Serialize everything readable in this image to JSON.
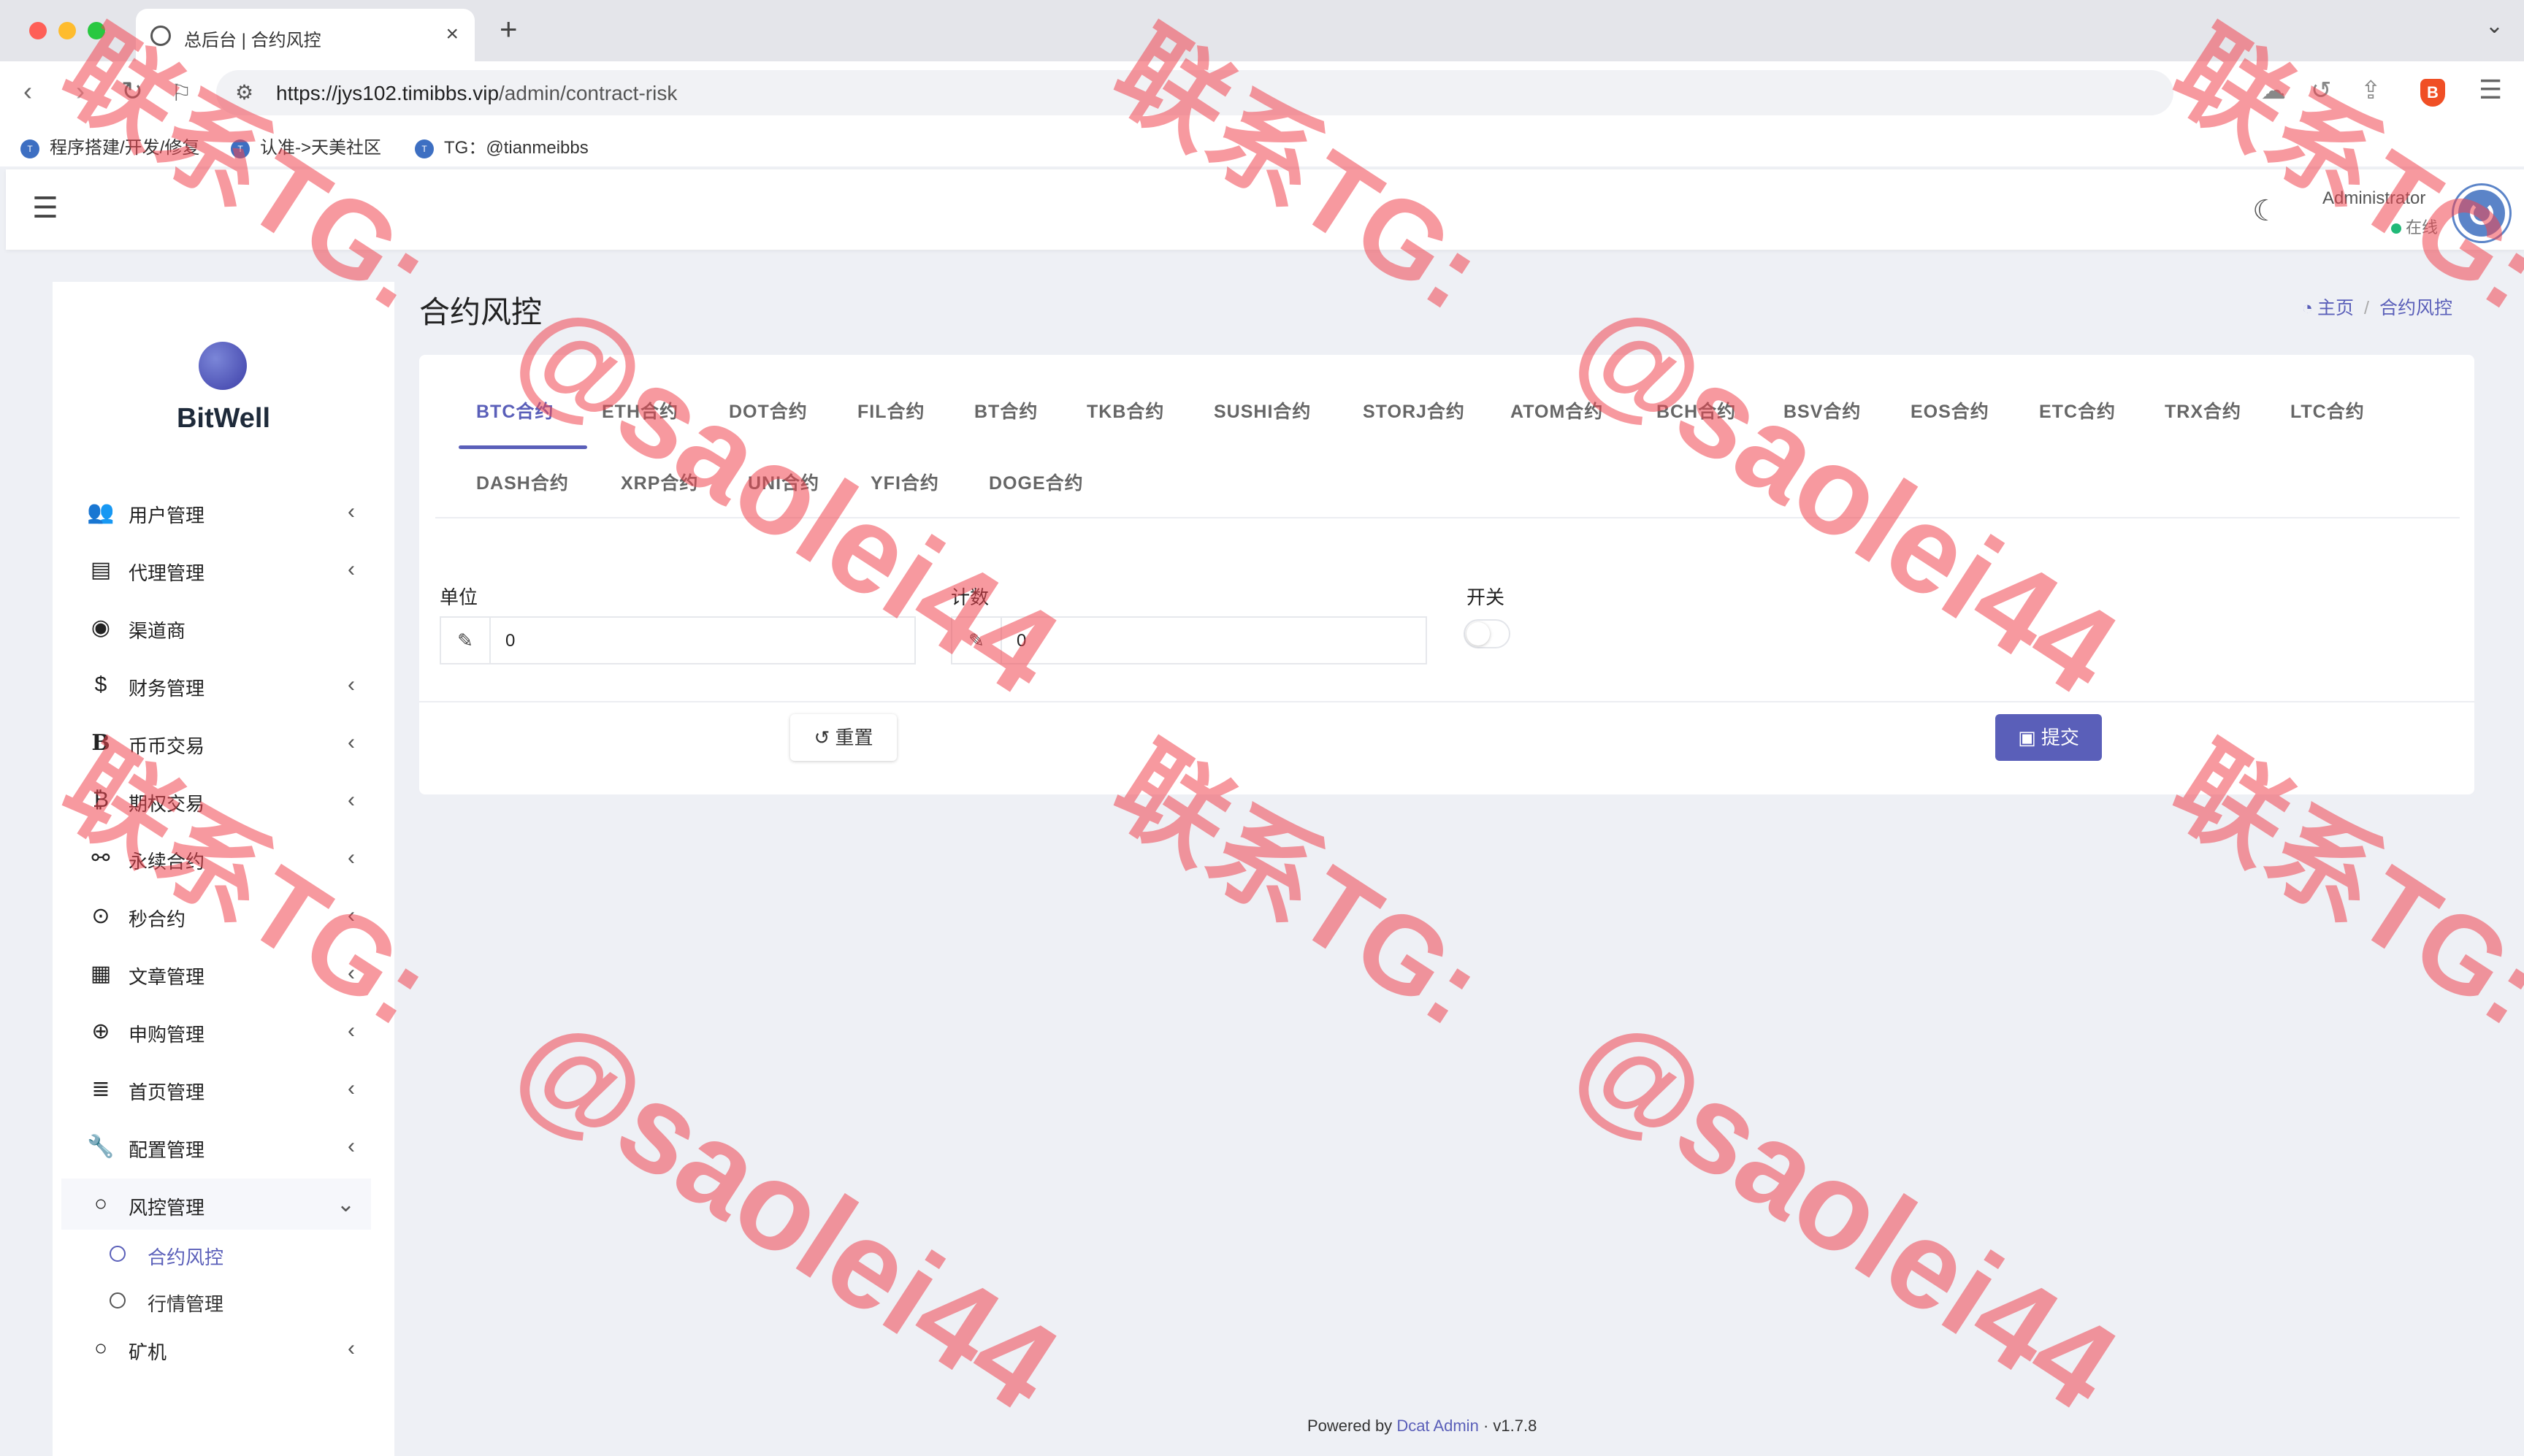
{
  "browser": {
    "tab_title": "总后台 | 合约风控",
    "tab_close": "×",
    "new_tab": "+",
    "tab_menu": "⌄",
    "url_host": "https://jys102.timibbs.vip",
    "url_path": "/admin/contract-risk",
    "bookmarks": [
      {
        "label": "程序搭建/开发/修复"
      },
      {
        "label": "认准->天美社区"
      },
      {
        "label": "TG：@tianmeibbs"
      }
    ]
  },
  "header": {
    "user_name": "Administrator",
    "user_status": "在线"
  },
  "sidebar": {
    "logo_text": "BitWell",
    "items": [
      {
        "label": "用户管理",
        "icon": "users-icon",
        "has_children": true
      },
      {
        "label": "代理管理",
        "icon": "id-card-icon",
        "has_children": true
      },
      {
        "label": "渠道商",
        "icon": "user-circle-icon",
        "has_children": false
      },
      {
        "label": "财务管理",
        "icon": "dollar-icon",
        "has_children": true
      },
      {
        "label": "币币交易",
        "icon": "bitcoin-b-icon",
        "has_children": true
      },
      {
        "label": "期权交易",
        "icon": "bitcoin-icon",
        "has_children": true
      },
      {
        "label": "永续合约",
        "icon": "link-icon",
        "has_children": true
      },
      {
        "label": "秒合约",
        "icon": "dot-circle-icon",
        "has_children": true
      },
      {
        "label": "文章管理",
        "icon": "newspaper-icon",
        "has_children": true
      },
      {
        "label": "申购管理",
        "icon": "life-ring-icon",
        "has_children": true
      },
      {
        "label": "首页管理",
        "icon": "list-icon",
        "has_children": true
      },
      {
        "label": "配置管理",
        "icon": "wrench-icon",
        "has_children": true
      },
      {
        "label": "风控管理",
        "icon": "circle-icon",
        "has_children": true,
        "expanded": true
      },
      {
        "label": "矿机",
        "icon": "circle-icon",
        "has_children": true
      }
    ],
    "risk_children": [
      {
        "label": "合约风控",
        "active": true
      },
      {
        "label": "行情管理",
        "active": false
      }
    ]
  },
  "page": {
    "title": "合约风控",
    "breadcrumb": [
      {
        "label": "主页"
      },
      {
        "label": "合约风控"
      }
    ]
  },
  "contract_tabs": {
    "active": "BTC合约",
    "items": [
      "BTC合约",
      "ETH合约",
      "DOT合约",
      "FIL合约",
      "BT合约",
      "TKB合约",
      "SUSHI合约",
      "STORJ合约",
      "ATOM合约",
      "BCH合约",
      "BSV合约",
      "EOS合约",
      "ETC合约",
      "TRX合约",
      "LTC合约",
      "DASH合约",
      "XRP合约",
      "UNI合约",
      "YFI合约",
      "DOGE合约"
    ]
  },
  "form": {
    "unit_label": "单位",
    "unit_value": "0",
    "count_label": "计数",
    "count_value": "0",
    "switch_label": "开关",
    "switch_on": false,
    "reset_label": "重置",
    "submit_label": "提交"
  },
  "footer": {
    "powered_by": "Powered by",
    "link": "Dcat Admin",
    "dot": "·",
    "version": "v1.7.8"
  },
  "watermark": {
    "contact": "联系TG:",
    "handle": "@saolei44"
  },
  "colors": {
    "accent": "#5a5fb9",
    "online": "#21b978",
    "watermark": "#f04650"
  }
}
